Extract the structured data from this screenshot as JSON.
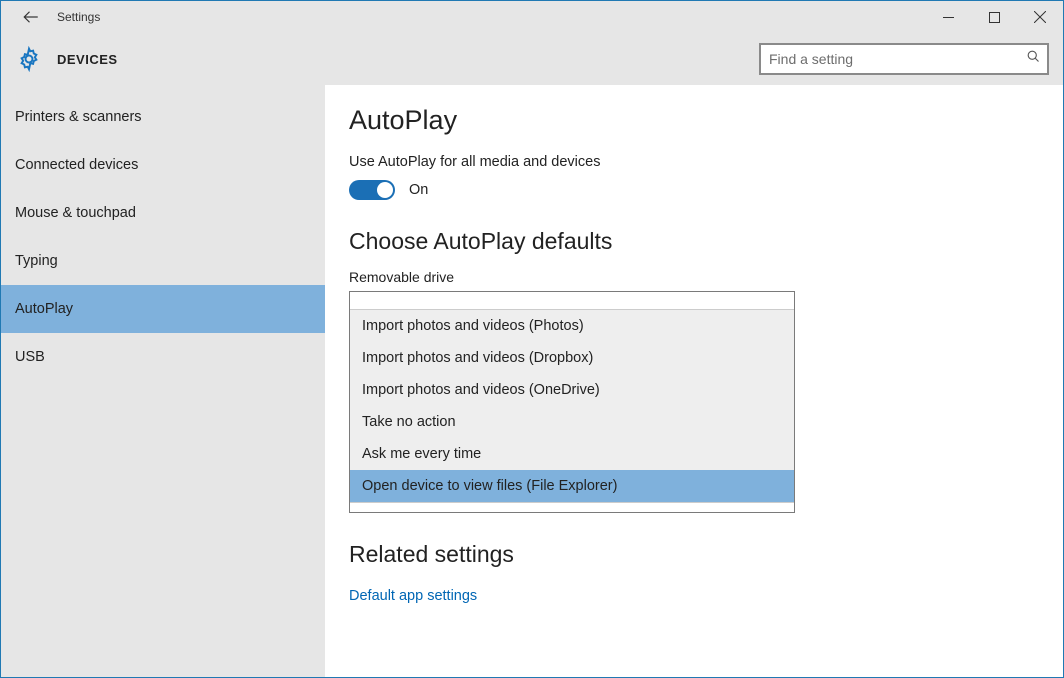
{
  "window": {
    "title": "Settings"
  },
  "header": {
    "section": "DEVICES",
    "search_placeholder": "Find a setting"
  },
  "sidebar": {
    "items": [
      {
        "label": "Printers & scanners"
      },
      {
        "label": "Connected devices"
      },
      {
        "label": "Mouse & touchpad"
      },
      {
        "label": "Typing"
      },
      {
        "label": "AutoPlay",
        "selected": true
      },
      {
        "label": "USB"
      }
    ]
  },
  "main": {
    "title": "AutoPlay",
    "toggle_caption": "Use AutoPlay for all media and devices",
    "toggle_state_label": "On",
    "defaults_heading": "Choose AutoPlay defaults",
    "removable_label": "Removable drive",
    "dropdown_options": [
      {
        "label": "Import photos and videos (Photos)"
      },
      {
        "label": "Import photos and videos (Dropbox)"
      },
      {
        "label": "Import photos and videos (OneDrive)"
      },
      {
        "label": "Take no action"
      },
      {
        "label": "Ask me every time"
      },
      {
        "label": "Open device to view files (File Explorer)",
        "selected": true
      }
    ],
    "related_heading": "Related settings",
    "related_link": "Default app settings"
  }
}
